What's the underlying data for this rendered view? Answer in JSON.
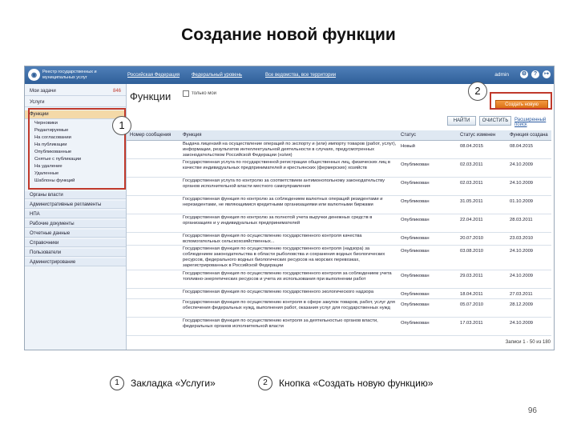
{
  "slide": {
    "title": "Создание новой функции",
    "page_number": "96"
  },
  "topbar": {
    "brand": "Реестр государственных и муниципальных услуг",
    "nav": [
      "Российская Федерация",
      "Федеральный уровень",
      "Все ведомства, все территории"
    ],
    "admin": "admin"
  },
  "sidebar": {
    "sections": [
      {
        "label": "Мои задачи",
        "count": "846"
      },
      {
        "label": "Услуги",
        "count": ""
      },
      {
        "label": "Функции",
        "count": ""
      }
    ],
    "functions_sub": [
      "Черновики",
      "Редактируемые",
      "На согласовании",
      "На публикации",
      "Опубликованные",
      "Снятые с публикации",
      "На удаление",
      "Удаленные",
      "Шаблоны функций"
    ],
    "lower": [
      "Органы власти",
      "Административные регламенты",
      "НПА",
      "Рабочие документы",
      "Отчетные данные",
      "Справочники",
      "Пользователи",
      "Администрирование"
    ]
  },
  "main": {
    "title": "Функции",
    "only_mine": "только мои",
    "find_button": "НАЙТИ",
    "clear_button": "ОЧИСТИТЬ",
    "advanced_search": "Расширенный поиск",
    "create_button": "Создать новую функцию",
    "columns": [
      "Номер сообщения",
      "Функция",
      "Статус",
      "Статус изменен",
      "Функция создана"
    ],
    "rows": [
      {
        "name": "Выдача лицензий на осуществление операций по экспорту и (или) импорту товаров (работ, услуг), информации, результатов интеллектуальной деятельности в случаях, предусмотренных законодательством Российской Федерации (нэ/ия)",
        "status": "Новый",
        "changed": "08.04.2015",
        "created": "08.04.2015"
      },
      {
        "name": "Государственная услуга по государственной регистрации общественных лиц, физических лиц в качестве индивидуальных предпринимателей и крестьянских (фермерских) хозяйств",
        "status": "Опубликован",
        "changed": "02.03.2011",
        "created": "24.10.2009"
      },
      {
        "name": "Государственная услуга по контролю за соответствием антимонопольному законодательству органов исполнительной власти местного самоуправления",
        "status": "Опубликован",
        "changed": "02.03.2011",
        "created": "24.10.2009"
      },
      {
        "name": "Государственная функция по контролю за соблюдением валютных операций резидентами и нерезидентами, не являющимися кредитными организациями или валютными биржами",
        "status": "Опубликован",
        "changed": "31.05.2011",
        "created": "01.10.2009"
      },
      {
        "name": "Государственная функция по контролю за полнотой учета выручки денежных средств в организациях и у индивидуальных предпринимателей",
        "status": "Опубликован",
        "changed": "22.04.2011",
        "created": "28.03.2011"
      },
      {
        "name": "Государственная функция по осуществлению государственного контроля качества вспомогательных сельскохозяйственных...",
        "status": "Опубликован",
        "changed": "20.07.2010",
        "created": "23.03.2010"
      },
      {
        "name": "Государственная функция по осуществлению государственного контроля (надзора) за соблюдением законодательства в области рыболовства и сохранения водных биологических ресурсов, федерального водных биологических ресурсов на морских перевозках, зарегистрированных в Российской Федерации",
        "status": "Опубликован",
        "changed": "03.08.2010",
        "created": "24.10.2009"
      },
      {
        "name": "Государственная функция по осуществлению государственного контроля за соблюдением учета топливно-энергетических ресурсов и учета их использования при выполнении работ",
        "status": "Опубликован",
        "changed": "29.03.2011",
        "created": "24.10.2009"
      },
      {
        "name": "Государственная функция по осуществлению государственного экологического надзора",
        "status": "Опубликован",
        "changed": "18.04.2011",
        "created": "27.03.2011"
      },
      {
        "name": "Государственная функция по осуществлению контроля в сфере закупок товаров, работ, услуг для обеспечения федеральных нужд, выполнения работ, оказания услуг для государственных нужд",
        "status": "Опубликован",
        "changed": "05.07.2010",
        "created": "28.12.2009"
      },
      {
        "name": "Государственная функция по осуществлению контроля за деятельностью органов власти, федеральных органов исполнительной власти",
        "status": "Опубликован",
        "changed": "17.03.2011",
        "created": "24.10.2009"
      }
    ],
    "pager": "Записи 1 - 50 из 180"
  },
  "callouts": {
    "one": "1",
    "two": "2"
  },
  "legend": [
    {
      "num": "1",
      "text": "Закладка «Услуги»"
    },
    {
      "num": "2",
      "text": "Кнопка «Создать новую функцию»"
    }
  ],
  "colors": {
    "highlight": "#c0392b",
    "header_blue": "#2f5f99",
    "create_orange": "#e07a20"
  }
}
